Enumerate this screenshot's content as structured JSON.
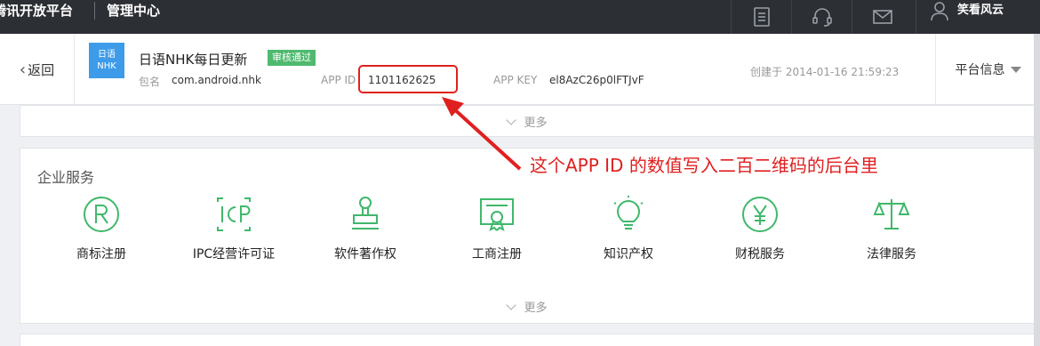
{
  "topbar": {
    "brand": "腾讯开放平台",
    "section": "管理中心",
    "icons": [
      "document-icon",
      "headset-icon",
      "mail-icon",
      "user-icon"
    ],
    "user_name": "笑看风云"
  },
  "app_header": {
    "back_label": "返回",
    "logo_line1": "日语",
    "logo_line2": "NHK",
    "app_name": "日语NHK每日更新",
    "status_badge": "审核通过",
    "package_label": "包名",
    "package_value": "com.android.nhk",
    "appid_label": "APP ID",
    "appid_value": "1101162625",
    "appkey_label": "APP KEY",
    "appkey_value": "el8AzC26p0lFTJvF",
    "created": "创建于 2014-01-16 21:59:23",
    "platform_menu": "平台信息"
  },
  "more_label": "更多",
  "enterprise": {
    "title": "企业服务",
    "services": [
      {
        "label": "商标注册",
        "icon": "trademark-icon"
      },
      {
        "label": "IPC经营许可证",
        "icon": "icp-icon"
      },
      {
        "label": "软件著作权",
        "icon": "stamp-icon"
      },
      {
        "label": "工商注册",
        "icon": "certificate-icon"
      },
      {
        "label": "知识产权",
        "icon": "lightbulb-icon"
      },
      {
        "label": "财税服务",
        "icon": "yen-icon"
      },
      {
        "label": "法律服务",
        "icon": "scales-icon"
      }
    ],
    "more_label": "更多"
  },
  "annotation": "这个APP ID 的数值写入二百二维码的后台里",
  "colors": {
    "topbar": "#2c2f34",
    "accent_green": "#3fb86a",
    "badge_green": "#4fba6f",
    "annotation_red": "#e02020",
    "logo_blue": "#3d9be9"
  }
}
